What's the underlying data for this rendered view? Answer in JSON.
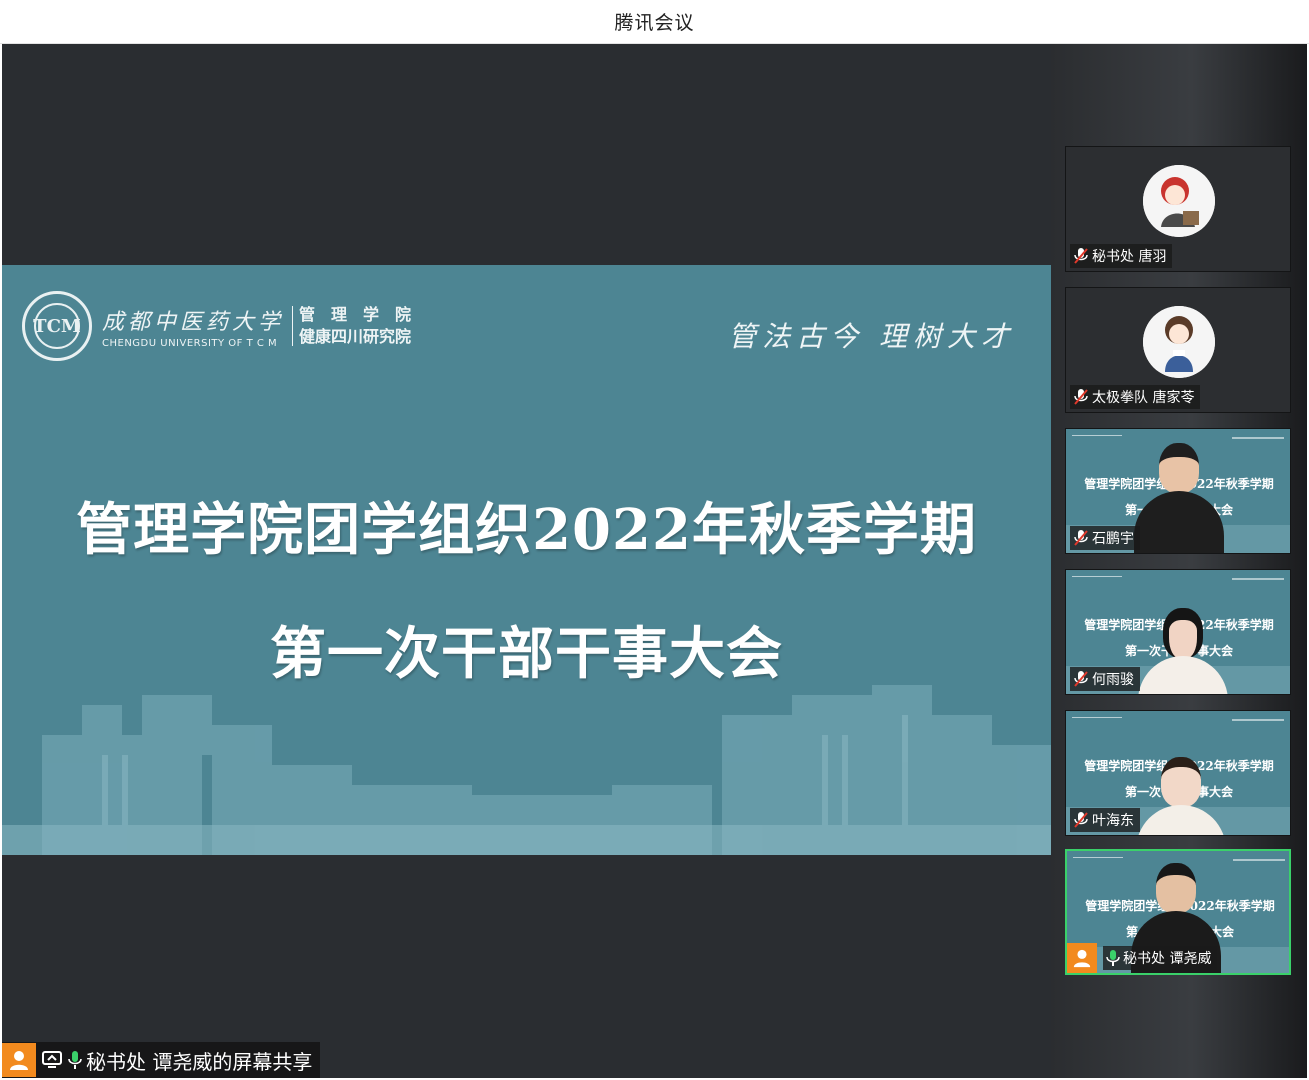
{
  "window": {
    "title": "腾讯会议"
  },
  "slide": {
    "university_cn": "成都中医药大学",
    "university_en": "CHENGDU UNIVERSITY OF T C M",
    "seal_text": "TCM",
    "dept_line1": "管理学院",
    "dept_line2": "健康四川研究院",
    "motto": "管法古今  理树大才",
    "title_line1": "管理学院团学组织2022年秋季学期",
    "title_line2": "第一次干部干事大会"
  },
  "share": {
    "label": "秘书处 谭尧威的屏幕共享"
  },
  "participants": [
    {
      "name": "秘书处 唐羽",
      "muted": true,
      "video": false
    },
    {
      "name": "太极拳队 唐家苓",
      "muted": true,
      "video": false
    },
    {
      "name": "石鹏宇",
      "muted": true,
      "video": true
    },
    {
      "name": "何雨骏",
      "muted": true,
      "video": true
    },
    {
      "name": "叶海东",
      "muted": true,
      "video": true
    },
    {
      "name": "秘书处 谭尧威",
      "muted": false,
      "video": true,
      "active": true
    }
  ],
  "mini_slide": {
    "title_line1": "管理学院团学组织2022年秋季学期",
    "title_line2": "第一次干部干事大会"
  },
  "colors": {
    "slide_bg": "#4d8593",
    "stage_bg": "#2a2d31",
    "accent_orange": "#f28a1e",
    "speaking_green": "#3ad16a",
    "muted_red": "#e0392b"
  },
  "icons": [
    "mic-muted-icon",
    "mic-on-icon",
    "user-avatar-icon",
    "screen-share-icon"
  ]
}
